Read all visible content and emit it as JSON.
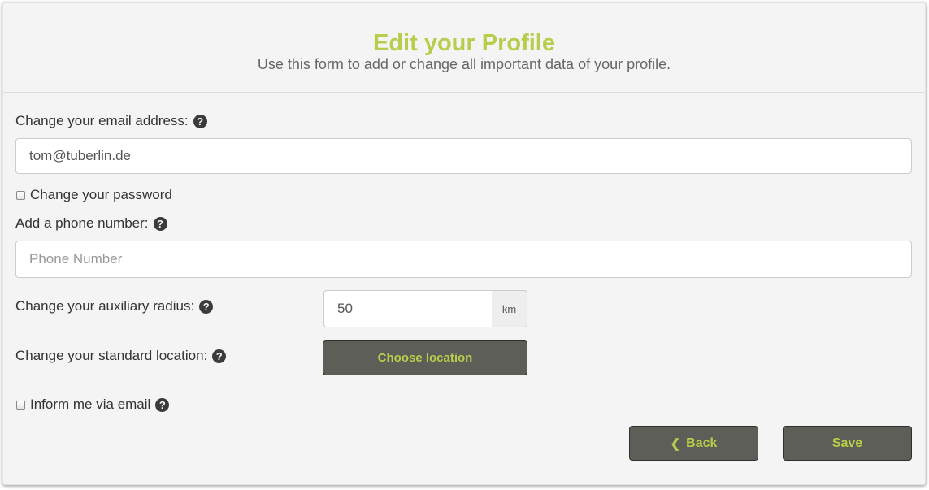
{
  "header": {
    "title": "Edit your Profile",
    "subtitle": "Use this form to add or change all important data of your profile."
  },
  "form": {
    "email": {
      "label": "Change your email address:",
      "value": "tom@tuberlin.de"
    },
    "change_password": {
      "label": "Change your password",
      "checked": false
    },
    "phone": {
      "label": "Add a phone number:",
      "placeholder": "Phone Number",
      "value": ""
    },
    "radius": {
      "label": "Change your auxiliary radius:",
      "value": "50",
      "unit": "km"
    },
    "location": {
      "label": "Change your standard location:",
      "button_label": "Choose location"
    },
    "inform_email": {
      "label": "Inform me via email",
      "checked": false
    }
  },
  "actions": {
    "back_label": "Back",
    "save_label": "Save"
  },
  "icons": {
    "help": "question-circle-icon",
    "back": "chevron-left-icon"
  },
  "colors": {
    "accent": "#b7cd4b",
    "button_bg": "#5c5e57",
    "panel_bg": "#f4f4f4"
  }
}
